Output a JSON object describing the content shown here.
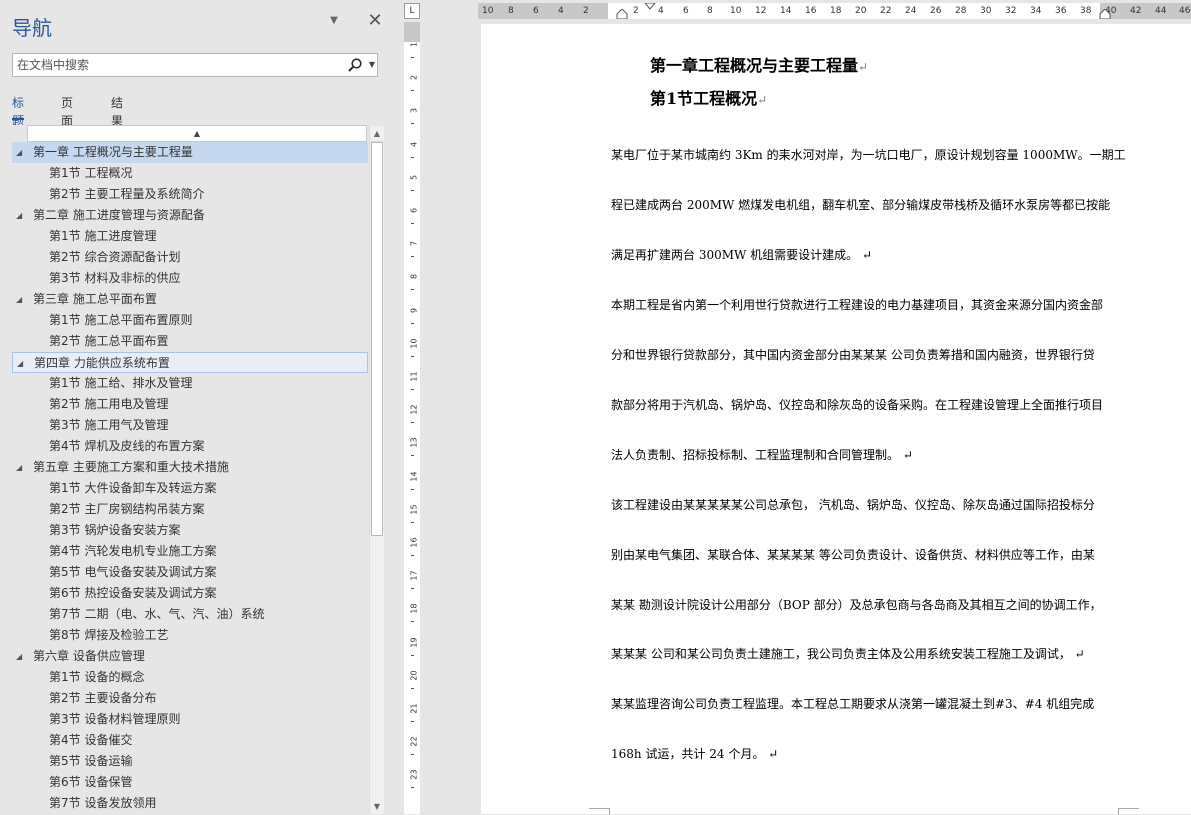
{
  "nav": {
    "title": "导航",
    "search_placeholder": "在文档中搜索",
    "tabs": [
      "标题",
      "页面",
      "结果"
    ],
    "items": [
      {
        "level": 1,
        "text": "第一章 工程概况与主要工程量"
      },
      {
        "level": 2,
        "text": "第1节 工程概况"
      },
      {
        "level": 2,
        "text": "第2节 主要工程量及系统简介"
      },
      {
        "level": 1,
        "text": "第二章 施工进度管理与资源配备"
      },
      {
        "level": 2,
        "text": "第1节 施工进度管理"
      },
      {
        "level": 2,
        "text": "第2节 综合资源配备计划"
      },
      {
        "level": 2,
        "text": "第3节 材料及非标的供应"
      },
      {
        "level": 1,
        "text": "第三章 施工总平面布置"
      },
      {
        "level": 2,
        "text": "第1节 施工总平面布置原则"
      },
      {
        "level": 2,
        "text": "第2节 施工总平面布置"
      },
      {
        "level": 1,
        "text": "第四章 力能供应系统布置"
      },
      {
        "level": 2,
        "text": "第1节 施工给、排水及管理"
      },
      {
        "level": 2,
        "text": "第2节 施工用电及管理"
      },
      {
        "level": 2,
        "text": "第3节 施工用气及管理"
      },
      {
        "level": 2,
        "text": "第4节 焊机及皮线的布置方案"
      },
      {
        "level": 1,
        "text": "第五章 主要施工方案和重大技术措施"
      },
      {
        "level": 2,
        "text": "第1节 大件设备卸车及转运方案"
      },
      {
        "level": 2,
        "text": "第2节 主厂房钢结构吊装方案"
      },
      {
        "level": 2,
        "text": "第3节 锅炉设备安装方案"
      },
      {
        "level": 2,
        "text": "第4节 汽轮发电机专业施工方案"
      },
      {
        "level": 2,
        "text": "第5节 电气设备安装及调试方案"
      },
      {
        "level": 2,
        "text": "第6节 热控设备安装及调试方案"
      },
      {
        "level": 2,
        "text": "第7节 二期（电、水、气、汽、油）系统"
      },
      {
        "level": 2,
        "text": "第8节 焊接及检验工艺"
      },
      {
        "level": 1,
        "text": "第六章 设备供应管理"
      },
      {
        "level": 2,
        "text": "第1节 设备的概念"
      },
      {
        "level": 2,
        "text": "第2节 主要设备分布"
      },
      {
        "level": 2,
        "text": "第3节 设备材料管理原则"
      },
      {
        "level": 2,
        "text": "第4节 设备催交"
      },
      {
        "level": 2,
        "text": "第5节 设备运输"
      },
      {
        "level": 2,
        "text": "第6节 设备保管"
      },
      {
        "level": 2,
        "text": "第7节 设备发放领用"
      }
    ]
  },
  "ruler": {
    "h_ticks": [
      "10",
      "8",
      "6",
      "4",
      "2",
      "2",
      "4",
      "6",
      "8",
      "10",
      "12",
      "14",
      "16",
      "18",
      "20",
      "22",
      "24",
      "26",
      "28",
      "30",
      "32",
      "34",
      "36",
      "38",
      "40",
      "42",
      "44",
      "46"
    ],
    "v_ticks": [
      "1",
      "2",
      "3",
      "4",
      "5",
      "6",
      "7",
      "8",
      "9",
      "10",
      "11",
      "12",
      "13",
      "14",
      "15",
      "16",
      "17",
      "18",
      "19",
      "20",
      "21",
      "22",
      "23"
    ],
    "corner": "L"
  },
  "document": {
    "heading1": "第一章工程概况与主要工程量",
    "heading2": "第1节工程概况",
    "para_mark": "↵",
    "lines": [
      "某电厂位于某市城南约 3Km 的耒水河对岸，为一坑口电厂，原设计规划容量 1000MW。一期工",
      "程已建成两台 200MW 燃煤发电机组，翻车机室、部分输煤皮带栈桥及循环水泵房等都已按能",
      "满足再扩建两台 300MW 机组需要设计建成。 ↵",
      "本期工程是省内第一个利用世行贷款进行工程建设的电力基建项目，其资金来源分国内资金部",
      "分和世界银行贷款部分，其中国内资金部分由某某某 公司负责筹措和国内融资，世界银行贷",
      "款部分将用于汽机岛、锅炉岛、仪控岛和除灰岛的设备采购。在工程建设管理上全面推行项目",
      "法人负责制、招标投标制、工程监理制和合同管理制。 ↵",
      "该工程建设由某某某某某公司总承包， 汽机岛、锅炉岛、仪控岛、除灰岛通过国际招投标分",
      "别由某电气集团、某联合体、某某某某 等公司负责设计、设备供货、材料供应等工作，由某",
      "某某 勘测设计院设计公用部分（BOP 部分）及总承包商与各岛商及其相互之间的协调工作，",
      "某某某 公司和某公司负责土建施工，我公司负责主体及公用系统安装工程施工及调试， ↵",
      "某某监理咨询公司负责工程监理。本工程总工期要求从浇第一罐混凝土到#3、#4 机组完成",
      "168h 试运，共计 24 个月。 ↵"
    ]
  }
}
